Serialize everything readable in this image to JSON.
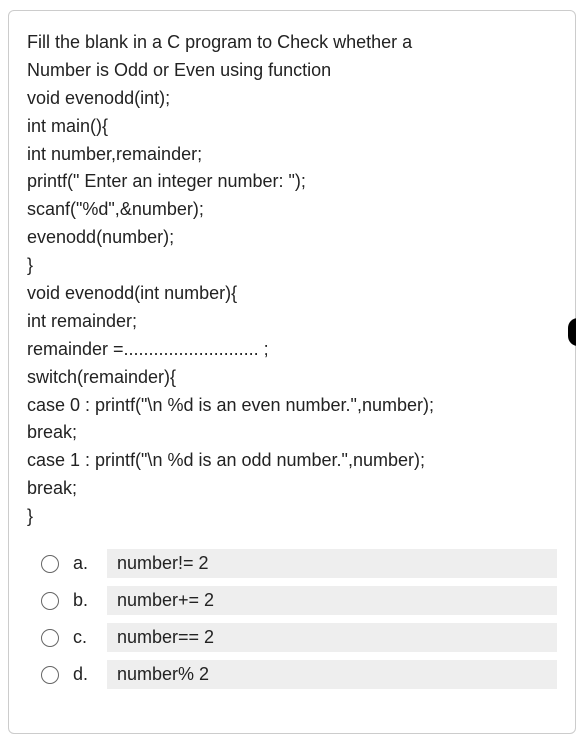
{
  "question": {
    "lines": [
      "Fill the blank in a C program to Check whether a",
      "Number is Odd or Even using function",
      "void evenodd(int);",
      "int main(){",
      "int number,remainder;",
      "printf(\" Enter an integer number: \");",
      "scanf(\"%d\",&number);",
      "evenodd(number);",
      "}",
      "void evenodd(int number){",
      "int remainder;",
      "remainder =........................... ;",
      "switch(remainder){",
      "case 0 : printf(\"\\n %d is an even number.\",number);",
      "break;",
      "case 1 : printf(\"\\n %d is an odd number.\",number);",
      "break;",
      "}"
    ]
  },
  "options": [
    {
      "letter": "a.",
      "text": "number!= 2"
    },
    {
      "letter": "b.",
      "text": "number+= 2"
    },
    {
      "letter": "c.",
      "text": "number== 2"
    },
    {
      "letter": "d.",
      "text": "number% 2"
    }
  ]
}
